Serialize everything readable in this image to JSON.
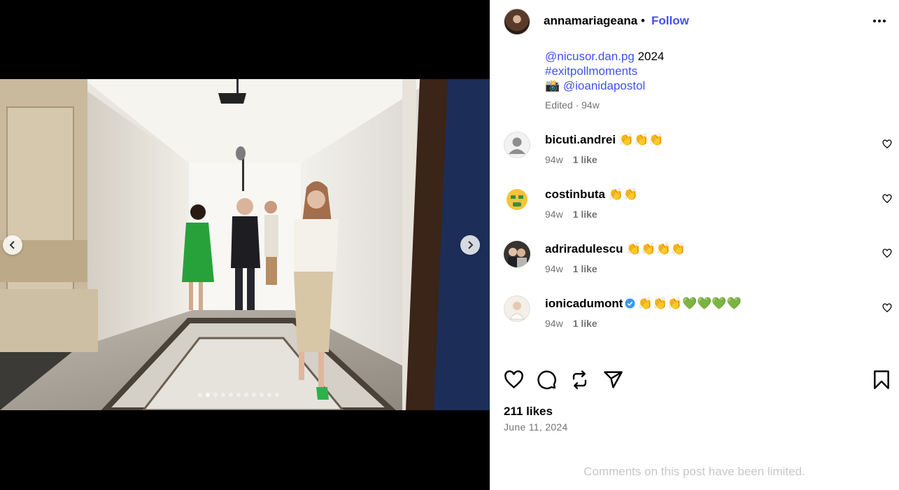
{
  "post": {
    "username": "annamariageana",
    "separator": "•",
    "follow_label": "Follow",
    "caption_lines": {
      "mention_1": "@nicusor.dan.pg",
      "year": " 2024",
      "hashtag": "#exitpollmoments",
      "camera": "📸 ",
      "mention_2": "@ioanidapostol"
    },
    "edited": "Edited · 94w",
    "likes": "211 likes",
    "date": "June 11, 2024",
    "comments_limited": "Comments on this post have been limited.",
    "carousel": {
      "total_slides": 11,
      "active_slide": 2
    }
  },
  "comments": [
    {
      "user": "bicuti.andrei",
      "text": "👏👏👏",
      "age": "94w",
      "likes": "1 like"
    },
    {
      "user": "costinbuta",
      "text": "👏👏",
      "age": "94w",
      "likes": "1 like"
    },
    {
      "user": "adriradulescu",
      "text": "👏👏👏👏",
      "age": "94w",
      "likes": "1 like"
    },
    {
      "user": "ionicadumont",
      "text": "👏👏👏💚💚💚💚",
      "age": "94w",
      "likes": "1 like",
      "verified": true
    }
  ],
  "icons": {
    "more": "more-options-icon",
    "like": "heart-icon",
    "comment": "comment-icon",
    "repost": "repost-icon",
    "share": "share-icon",
    "save": "bookmark-icon"
  },
  "colors": {
    "link": "#4150f7",
    "muted": "#737373",
    "verified": "#3897f0"
  }
}
